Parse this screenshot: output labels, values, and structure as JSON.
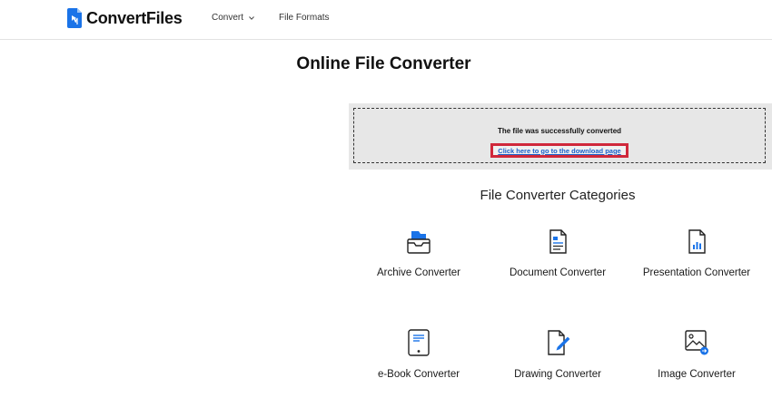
{
  "header": {
    "brand": "ConvertFiles",
    "nav": [
      {
        "label": "Convert",
        "has_dropdown": true
      },
      {
        "label": "File Formats",
        "has_dropdown": false
      }
    ]
  },
  "page_title": "Online File Converter",
  "notice": {
    "message": "The file was successfully converted",
    "link_text": "Click here to go to the download page",
    "highlight_color": "#d0283b"
  },
  "categories": {
    "title": "File Converter Categories",
    "items": [
      {
        "label": "Archive Converter",
        "icon": "archive-icon"
      },
      {
        "label": "Document Converter",
        "icon": "document-icon"
      },
      {
        "label": "Presentation Converter",
        "icon": "presentation-icon"
      },
      {
        "label": "e-Book Converter",
        "icon": "ebook-icon"
      },
      {
        "label": "Drawing Converter",
        "icon": "drawing-icon"
      },
      {
        "label": "Image Converter",
        "icon": "image-icon"
      }
    ]
  },
  "colors": {
    "accent_blue": "#1a73e8",
    "link_blue": "#1a5fc9",
    "notice_bg": "#e7e7e7"
  }
}
